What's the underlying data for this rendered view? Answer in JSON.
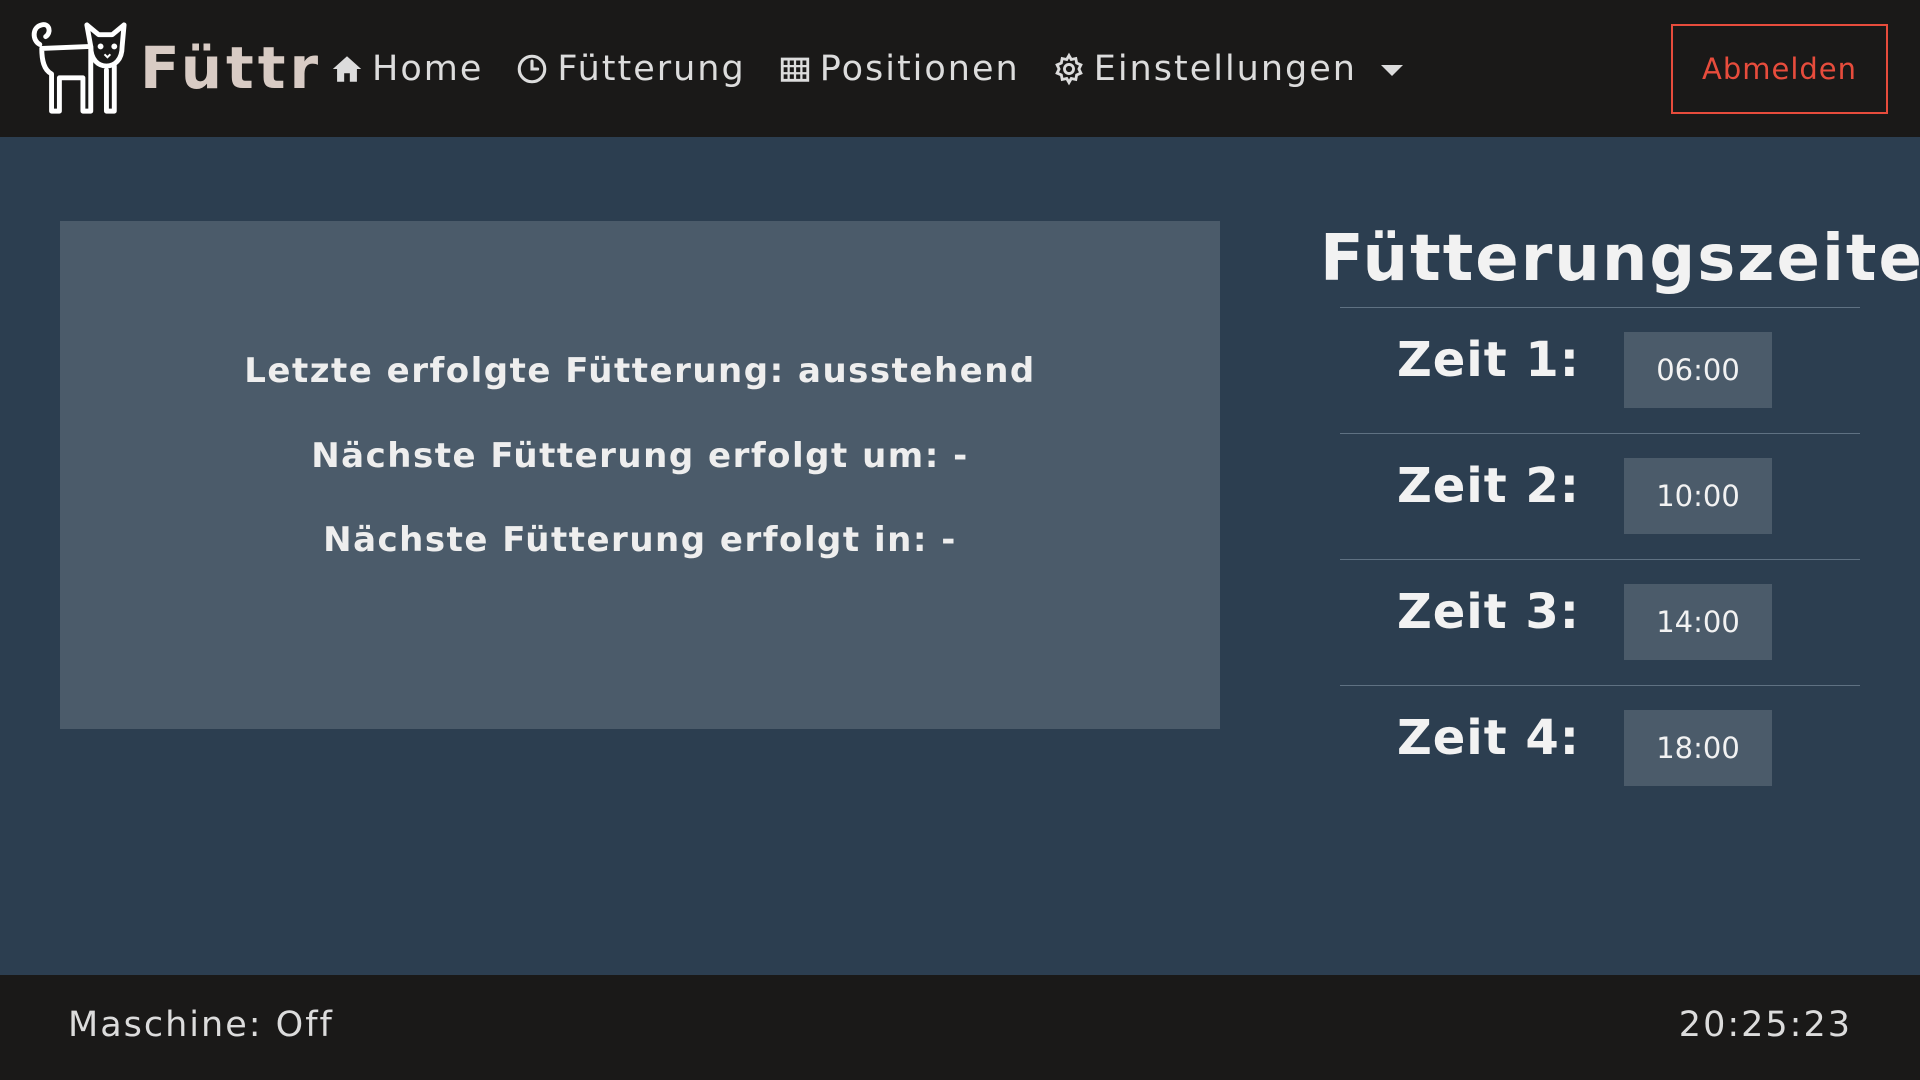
{
  "brand": {
    "logo_icon": "cat-icon",
    "name": "Füttr"
  },
  "nav": {
    "items": [
      {
        "label": "Home",
        "icon": "home-icon"
      },
      {
        "label": "Fütterung",
        "icon": "clock-icon"
      },
      {
        "label": "Positionen",
        "icon": "grid-icon"
      },
      {
        "label": "Einstellungen",
        "icon": "gear-icon",
        "has_dropdown": true
      }
    ],
    "logout_label": "Abmelden"
  },
  "status": {
    "last_feeding": "Letzte erfolgte Fütterung: ausstehend",
    "next_feeding_at": "Nächste Fütterung erfolgt um: -",
    "next_feeding_in": "Nächste Fütterung erfolgt in: -"
  },
  "times": {
    "title": "Fütterungszeiten",
    "rows": [
      {
        "label": "Zeit 1:",
        "value": "06:00"
      },
      {
        "label": "Zeit 2:",
        "value": "10:00"
      },
      {
        "label": "Zeit 3:",
        "value": "14:00"
      },
      {
        "label": "Zeit 4:",
        "value": "18:00"
      }
    ]
  },
  "footer": {
    "machine_status": "Maschine: Off",
    "clock": "20:25:23"
  },
  "colors": {
    "navbar_bg": "#1a1918",
    "page_bg": "#2c3e50",
    "panel_bg": "#4b5b6a",
    "logout_accent": "#e74c3c"
  }
}
